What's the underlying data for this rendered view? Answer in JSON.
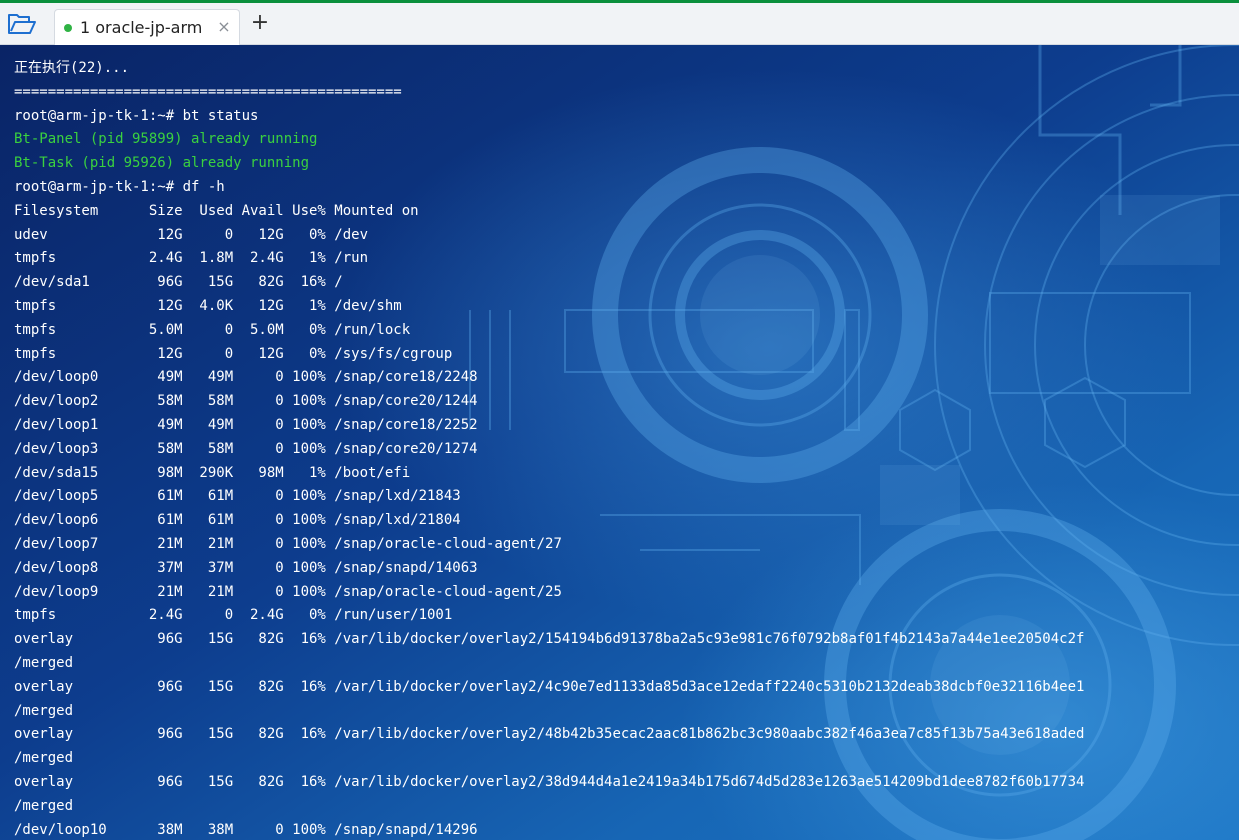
{
  "tabbar": {
    "folder_icon": "folder-open-icon",
    "tab": {
      "status_color": "#2fb344",
      "label": "1 oracle-jp-arm",
      "close_symbol": "×"
    },
    "add_symbol": "+"
  },
  "terminal": {
    "text_color": "#ffffff",
    "success_color": "#3ad13f",
    "lines": [
      "正在执行(22)...",
      "==============================================",
      "root@arm-jp-tk-1:~# bt status",
      "Bt-Panel (pid 95899) already running",
      "Bt-Task (pid 95926) already running",
      "root@arm-jp-tk-1:~# df -h",
      "Filesystem      Size  Used Avail Use% Mounted on",
      "udev             12G     0   12G   0% /dev",
      "tmpfs           2.4G  1.8M  2.4G   1% /run",
      "/dev/sda1        96G   15G   82G  16% /",
      "tmpfs            12G  4.0K   12G   1% /dev/shm",
      "tmpfs           5.0M     0  5.0M   0% /run/lock",
      "tmpfs            12G     0   12G   0% /sys/fs/cgroup",
      "/dev/loop0       49M   49M     0 100% /snap/core18/2248",
      "/dev/loop2       58M   58M     0 100% /snap/core20/1244",
      "/dev/loop1       49M   49M     0 100% /snap/core18/2252",
      "/dev/loop3       58M   58M     0 100% /snap/core20/1274",
      "/dev/sda15       98M  290K   98M   1% /boot/efi",
      "/dev/loop5       61M   61M     0 100% /snap/lxd/21843",
      "/dev/loop6       61M   61M     0 100% /snap/lxd/21804",
      "/dev/loop7       21M   21M     0 100% /snap/oracle-cloud-agent/27",
      "/dev/loop8       37M   37M     0 100% /snap/snapd/14063",
      "/dev/loop9       21M   21M     0 100% /snap/oracle-cloud-agent/25",
      "tmpfs           2.4G     0  2.4G   0% /run/user/1001",
      "overlay          96G   15G   82G  16% /var/lib/docker/overlay2/154194b6d91378ba2a5c93e981c76f0792b8af01f4b2143a7a44e1ee20504c2f",
      "/merged",
      "overlay          96G   15G   82G  16% /var/lib/docker/overlay2/4c90e7ed1133da85d3ace12edaff2240c5310b2132deab38dcbf0e32116b4ee1",
      "/merged",
      "overlay          96G   15G   82G  16% /var/lib/docker/overlay2/48b42b35ecac2aac81b862bc3c980aabc382f46a3ea7c85f13b75a43e618aded",
      "/merged",
      "overlay          96G   15G   82G  16% /var/lib/docker/overlay2/38d944d4a1e2419a34b175d674d5d283e1263ae514209bd1dee8782f60b17734",
      "/merged",
      "/dev/loop10      38M   38M     0 100% /snap/snapd/14296"
    ]
  }
}
